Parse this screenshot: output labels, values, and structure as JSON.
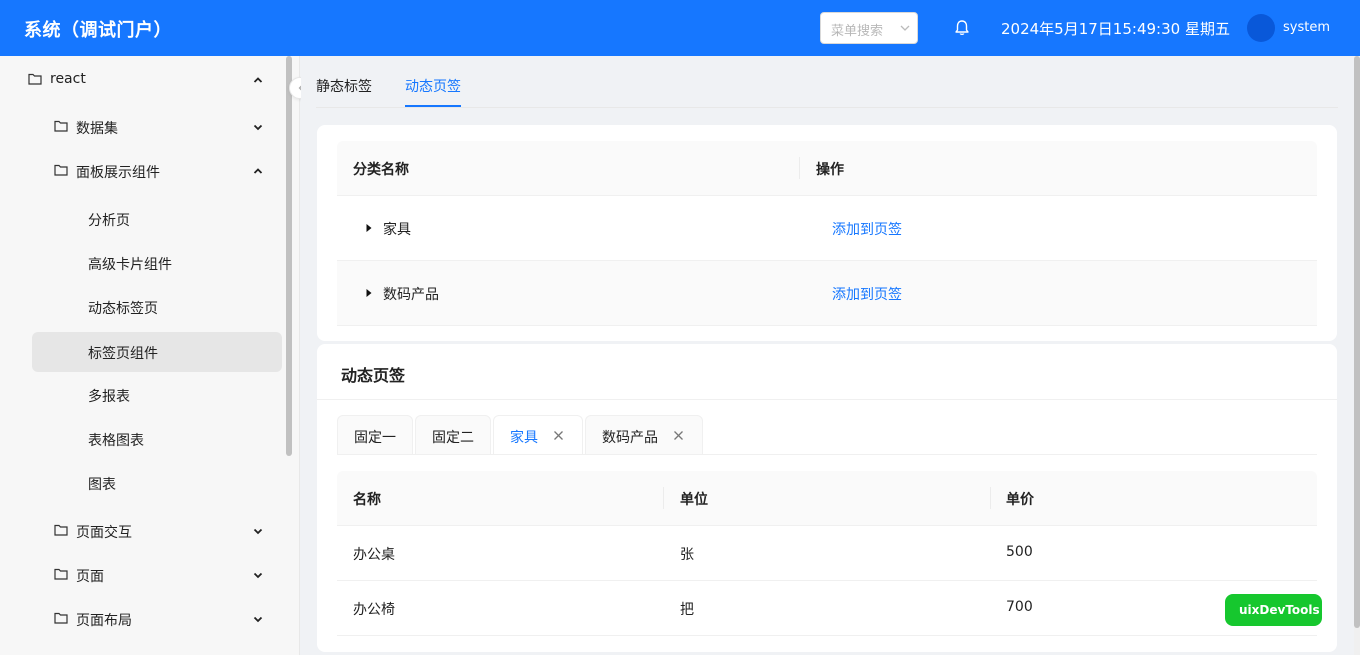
{
  "header": {
    "title": "系统（调试门户）",
    "menu_search_placeholder": "菜单搜索",
    "datetime": "2024年5月17日15:49:30 星期五",
    "username": "system",
    "colors": {
      "primary": "#1677ff"
    }
  },
  "sidebar": {
    "items": [
      {
        "label": "react",
        "icon": "folder-icon",
        "expanded": true
      },
      {
        "label": "数据集",
        "icon": "folder-icon",
        "expanded": false
      },
      {
        "label": "面板展示组件",
        "icon": "folder-icon",
        "expanded": true
      },
      {
        "label": "分析页"
      },
      {
        "label": "高级卡片组件"
      },
      {
        "label": "动态标签页"
      },
      {
        "label": "标签页组件",
        "active": true
      },
      {
        "label": "多报表"
      },
      {
        "label": "表格图表"
      },
      {
        "label": "图表"
      },
      {
        "label": "页面交互",
        "icon": "folder-icon",
        "expanded": false
      },
      {
        "label": "页面",
        "icon": "folder-icon",
        "expanded": false
      },
      {
        "label": "页面布局",
        "icon": "folder-icon",
        "expanded": false
      }
    ]
  },
  "main": {
    "tabs": [
      {
        "label": "静态标签"
      },
      {
        "label": "动态页签",
        "active": true
      }
    ],
    "category_table": {
      "headers": [
        "分类名称",
        "操作"
      ],
      "rows": [
        {
          "name": "家具",
          "action": "添加到页签"
        },
        {
          "name": "数码产品",
          "action": "添加到页签"
        }
      ]
    },
    "dynamic_panel": {
      "title": "动态页签",
      "tabs": [
        {
          "label": "固定一",
          "closable": false
        },
        {
          "label": "固定二",
          "closable": false
        },
        {
          "label": "家具",
          "closable": true,
          "active": true
        },
        {
          "label": "数码产品",
          "closable": true
        }
      ],
      "table": {
        "headers": [
          "名称",
          "单位",
          "单价"
        ],
        "rows": [
          [
            "办公桌",
            "张",
            "500"
          ],
          [
            "办公椅",
            "把",
            "700"
          ]
        ]
      }
    }
  },
  "devtools": {
    "label": "uixDevTools",
    "color": "#16c72e"
  }
}
